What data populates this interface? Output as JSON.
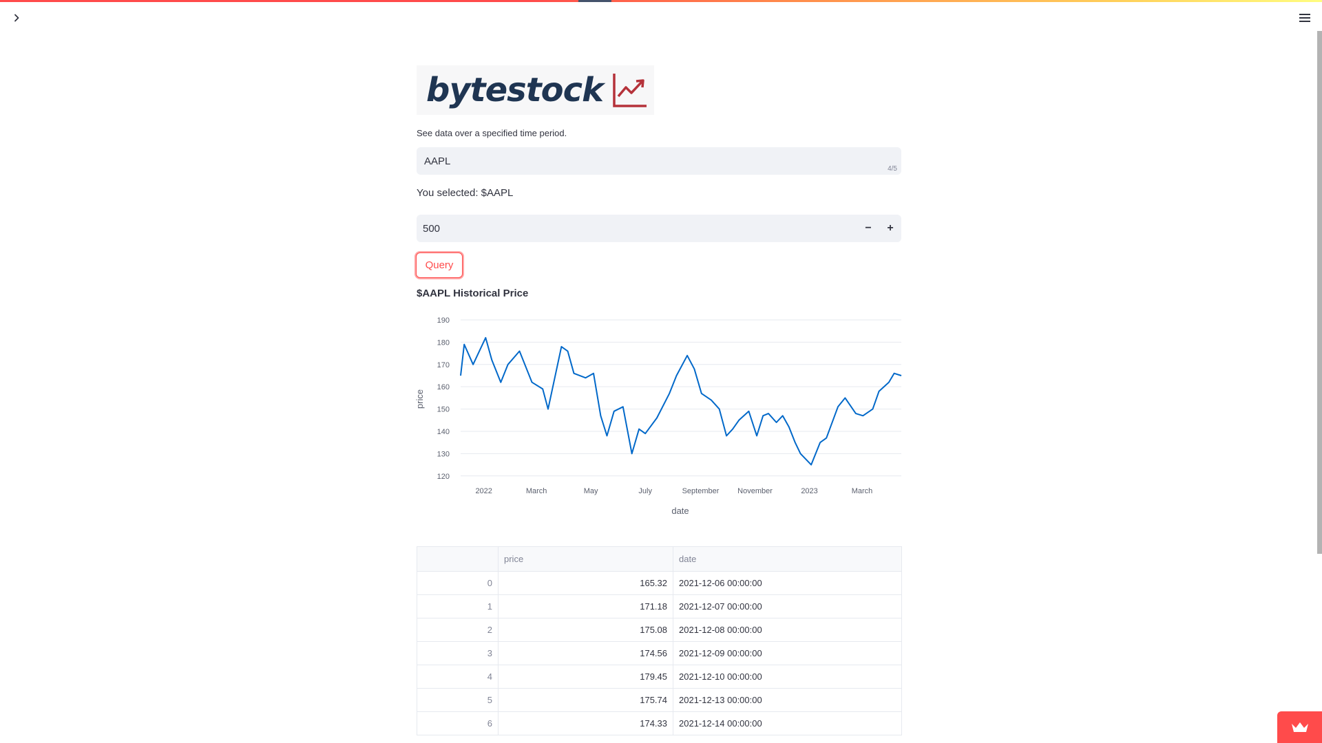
{
  "app": {
    "logo_text": "bytestock",
    "caption": "See data over a specified time period.",
    "accent_color": "#ff4b4b",
    "logo_color": "#1f3552",
    "logo_mark_color": "#b5323a"
  },
  "ticker_input": {
    "value": "AAPL",
    "char_count": "4/5"
  },
  "selected_text": "You selected: $AAPL",
  "number_input": {
    "value": "500",
    "decrement_label": "−",
    "increment_label": "+"
  },
  "query_button": {
    "label": "Query"
  },
  "chart_title": "$AAPL Historical Price",
  "chart_data": {
    "type": "line",
    "title": "$AAPL Historical Price",
    "xlabel": "date",
    "ylabel": "price",
    "x_ticks": [
      "2022",
      "March",
      "May",
      "July",
      "September",
      "November",
      "2023",
      "March"
    ],
    "y_ticks": [
      120,
      130,
      140,
      150,
      160,
      170,
      180,
      190
    ],
    "ylim": [
      119,
      190
    ],
    "xlim": [
      "2021-12-06",
      "2023-04-14"
    ],
    "grid": true,
    "line_color": "#0068c9",
    "series": [
      {
        "x": [
          "2021-12-06",
          "2021-12-10",
          "2021-12-20",
          "2022-01-03",
          "2022-01-10",
          "2022-01-20",
          "2022-01-28",
          "2022-02-10",
          "2022-02-24",
          "2022-03-08",
          "2022-03-14",
          "2022-03-29",
          "2022-04-05",
          "2022-04-12",
          "2022-04-25",
          "2022-05-04",
          "2022-05-12",
          "2022-05-19",
          "2022-05-27",
          "2022-06-06",
          "2022-06-16",
          "2022-06-24",
          "2022-07-01",
          "2022-07-14",
          "2022-07-28",
          "2022-08-05",
          "2022-08-17",
          "2022-08-25",
          "2022-09-02",
          "2022-09-13",
          "2022-09-22",
          "2022-09-30",
          "2022-10-07",
          "2022-10-14",
          "2022-10-25",
          "2022-11-03",
          "2022-11-10",
          "2022-11-16",
          "2022-11-25",
          "2022-12-02",
          "2022-12-09",
          "2022-12-16",
          "2022-12-22",
          "2023-01-03",
          "2023-01-13",
          "2023-01-20",
          "2023-02-02",
          "2023-02-10",
          "2023-02-22",
          "2023-03-02",
          "2023-03-13",
          "2023-03-20",
          "2023-03-31",
          "2023-04-06",
          "2023-04-14"
        ],
        "y": [
          165,
          179,
          170,
          182,
          172,
          162,
          170,
          176,
          162,
          159,
          150,
          178,
          176,
          166,
          164,
          166,
          147,
          138,
          149,
          151,
          130,
          141,
          139,
          146,
          157,
          165,
          174,
          168,
          157,
          154,
          150,
          138,
          141,
          145,
          149,
          138,
          147,
          148,
          144,
          147,
          142,
          135,
          130,
          125,
          135,
          137,
          151,
          155,
          148,
          147,
          150,
          158,
          162,
          166,
          165
        ]
      }
    ]
  },
  "table": {
    "columns": [
      "",
      "price",
      "date"
    ],
    "rows": [
      {
        "index": "0",
        "price": "165.32",
        "date": "2021-12-06 00:00:00"
      },
      {
        "index": "1",
        "price": "171.18",
        "date": "2021-12-07 00:00:00"
      },
      {
        "index": "2",
        "price": "175.08",
        "date": "2021-12-08 00:00:00"
      },
      {
        "index": "3",
        "price": "174.56",
        "date": "2021-12-09 00:00:00"
      },
      {
        "index": "4",
        "price": "179.45",
        "date": "2021-12-10 00:00:00"
      },
      {
        "index": "5",
        "price": "175.74",
        "date": "2021-12-13 00:00:00"
      },
      {
        "index": "6",
        "price": "174.33",
        "date": "2021-12-14 00:00:00"
      }
    ]
  },
  "icons": {
    "sidebar_toggle": "chevron-right-icon",
    "menu": "hamburger-menu-icon",
    "badge": "crown-icon"
  }
}
